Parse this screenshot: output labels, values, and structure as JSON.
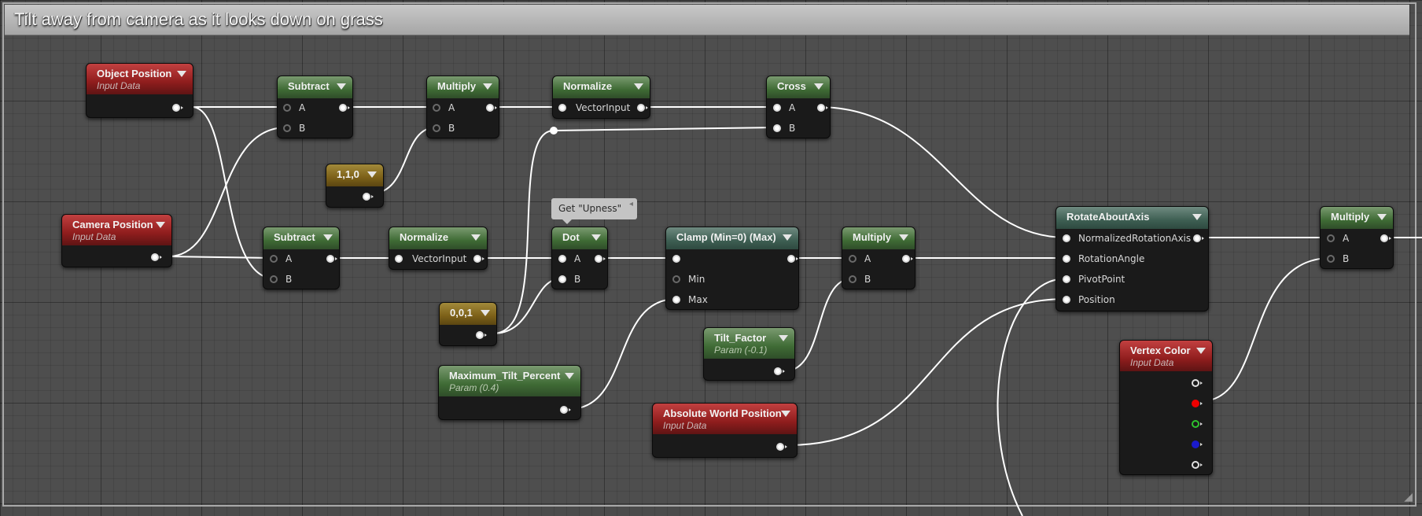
{
  "comment": {
    "title": "Tilt away from camera as it looks down on grass",
    "resize_icon": "resize-grip-icon"
  },
  "tooltip_comment": {
    "text": "Get \"Upness\""
  },
  "colors": {
    "header_green": "#3f6b35",
    "header_red": "#8f1d1d",
    "header_yellow": "#7c6018",
    "header_teal": "#3e5f53",
    "wire": "#ffffff",
    "pin_red": "#ee0000",
    "pin_green": "#2ec22e",
    "pin_blue": "#1a1acc"
  },
  "nodes": {
    "object_position": {
      "title": "Object Position",
      "subtitle": "Input Data"
    },
    "camera_position": {
      "title": "Camera Position",
      "subtitle": "Input Data"
    },
    "subtract_1": {
      "title": "Subtract",
      "pin_a": "A",
      "pin_b": "B"
    },
    "subtract_2": {
      "title": "Subtract",
      "pin_a": "A",
      "pin_b": "B"
    },
    "constant_110": {
      "title": "1,1,0"
    },
    "multiply_1": {
      "title": "Multiply",
      "pin_a": "A",
      "pin_b": "B"
    },
    "normalize_1": {
      "title": "Normalize",
      "pin_input": "VectorInput"
    },
    "normalize_2": {
      "title": "Normalize",
      "pin_input": "VectorInput"
    },
    "cross": {
      "title": "Cross",
      "pin_a": "A",
      "pin_b": "B"
    },
    "dot": {
      "title": "Dot",
      "pin_a": "A",
      "pin_b": "B"
    },
    "constant_001": {
      "title": "0,0,1"
    },
    "clamp": {
      "title": "Clamp (Min=0) (Max)",
      "pin_min": "Min",
      "pin_max": "Max"
    },
    "multiply_2": {
      "title": "Multiply",
      "pin_a": "A",
      "pin_b": "B"
    },
    "tilt_factor": {
      "title": "Tilt_Factor",
      "subtitle": "Param (-0.1)"
    },
    "max_tilt": {
      "title": "Maximum_Tilt_Percent",
      "subtitle": "Param (0.4)"
    },
    "abs_world_pos": {
      "title": "Absolute World Position",
      "subtitle": "Input Data"
    },
    "rotate_about_axis": {
      "title": "RotateAboutAxis",
      "pin_axis": "NormalizedRotationAxis",
      "pin_angle": "RotationAngle",
      "pin_pivot": "PivotPoint",
      "pin_position": "Position"
    },
    "vertex_color": {
      "title": "Vertex Color",
      "subtitle": "Input Data"
    },
    "multiply_3": {
      "title": "Multiply",
      "pin_a": "A",
      "pin_b": "B"
    }
  }
}
